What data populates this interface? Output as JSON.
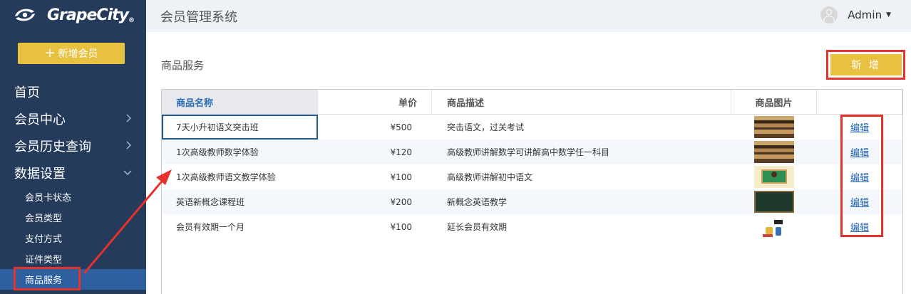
{
  "brand": {
    "name": "GrapeCity",
    "mark": "®"
  },
  "sidebar": {
    "add_member_label": "新增会员",
    "items": [
      {
        "label": "首页",
        "has_children": false
      },
      {
        "label": "会员中心",
        "has_children": true
      },
      {
        "label": "会员历史查询",
        "has_children": true
      },
      {
        "label": "数据设置",
        "has_children": true,
        "expanded": true
      }
    ],
    "subitems": [
      {
        "label": "会员卡状态"
      },
      {
        "label": "会员类型"
      },
      {
        "label": "支付方式"
      },
      {
        "label": "证件类型"
      },
      {
        "label": "商品服务",
        "active": true
      }
    ]
  },
  "header": {
    "title": "会员管理系统",
    "user": "Admin"
  },
  "main": {
    "section_title": "商品服务",
    "new_button_label": "新 增",
    "columns": {
      "name": "商品名称",
      "price": "单价",
      "desc": "商品描述",
      "image": "商品图片"
    },
    "rows": [
      {
        "name": "7天小升初语文突击班",
        "price": "¥500",
        "desc": "突击语文，过关考试",
        "image": "classroom-photo",
        "edit": "编辑"
      },
      {
        "name": "1次高级教师数学体验",
        "price": "¥120",
        "desc": "高级教师讲解数学可讲解高中数学任一科目",
        "image": "classroom-photo",
        "edit": "编辑"
      },
      {
        "name": "1次高级教师语文教学体验",
        "price": "¥100",
        "desc": "高级教师讲解初中语文",
        "image": "teacher-illustration",
        "edit": "编辑"
      },
      {
        "name": "英语新概念课程班",
        "price": "¥200",
        "desc": "新概念英语教学",
        "image": "blackboard-photo",
        "edit": "编辑"
      },
      {
        "name": "会员有效期一个月",
        "price": "¥100",
        "desc": "延长会员有效期",
        "image": "education-icons",
        "edit": "编辑"
      }
    ]
  },
  "colors": {
    "sidebar_bg": "#243b5c",
    "accent_yellow": "#e8c141",
    "active_blue": "#2e5f9e",
    "annotation_red": "#e5322d",
    "link_blue": "#1f63b5"
  }
}
